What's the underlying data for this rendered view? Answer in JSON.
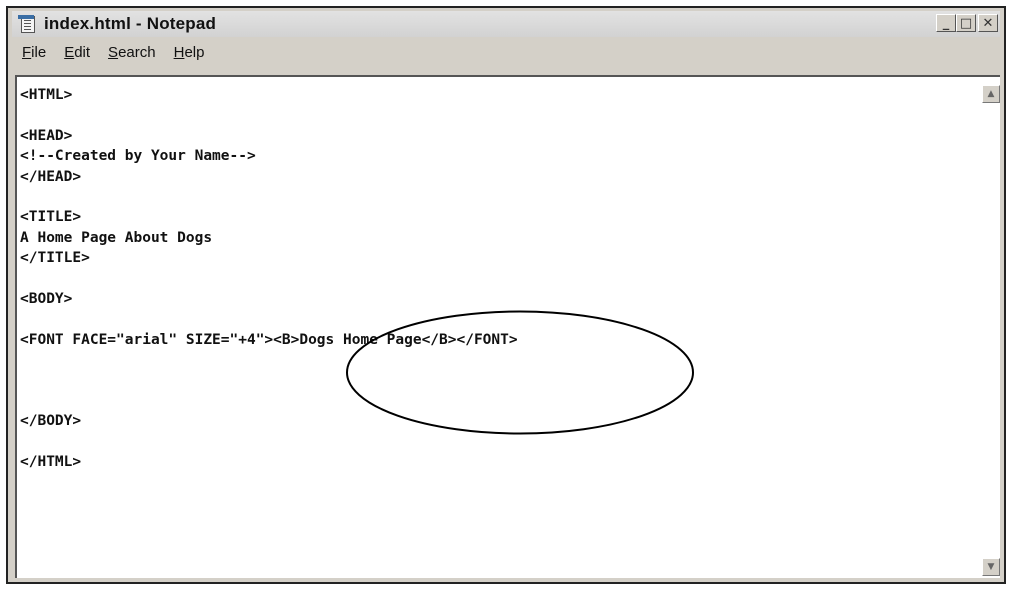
{
  "window": {
    "title": "index.html - Notepad",
    "controls": [
      "minimize-icon",
      "maximize-icon",
      "close-icon"
    ]
  },
  "menu": {
    "file": {
      "acc": "F",
      "rest": "ile"
    },
    "edit": {
      "acc": "E",
      "rest": "dit"
    },
    "search": {
      "acc": "S",
      "rest": "earch"
    },
    "help": {
      "acc": "H",
      "rest": "elp"
    }
  },
  "editor": {
    "lines": [
      "<HTML>",
      "",
      "<HEAD>",
      "<!--Created by Your Name-->",
      "</HEAD>",
      "",
      "<TITLE>",
      "A Home Page About Dogs",
      "</TITLE>",
      "",
      "<BODY>",
      "",
      "<FONT FACE=\"arial\" SIZE=\"+4\"><B>Dogs Home Page</B></FONT>",
      "",
      "",
      "",
      "</BODY>",
      "",
      "</HTML>"
    ]
  },
  "annotation": {
    "shape": "ellipse",
    "color": "#000000",
    "encircles": "+4\"><B>Dogs Home Page</B></FO"
  },
  "scrollbar": {
    "up_arrow": "▲",
    "down_arrow": "▼"
  }
}
